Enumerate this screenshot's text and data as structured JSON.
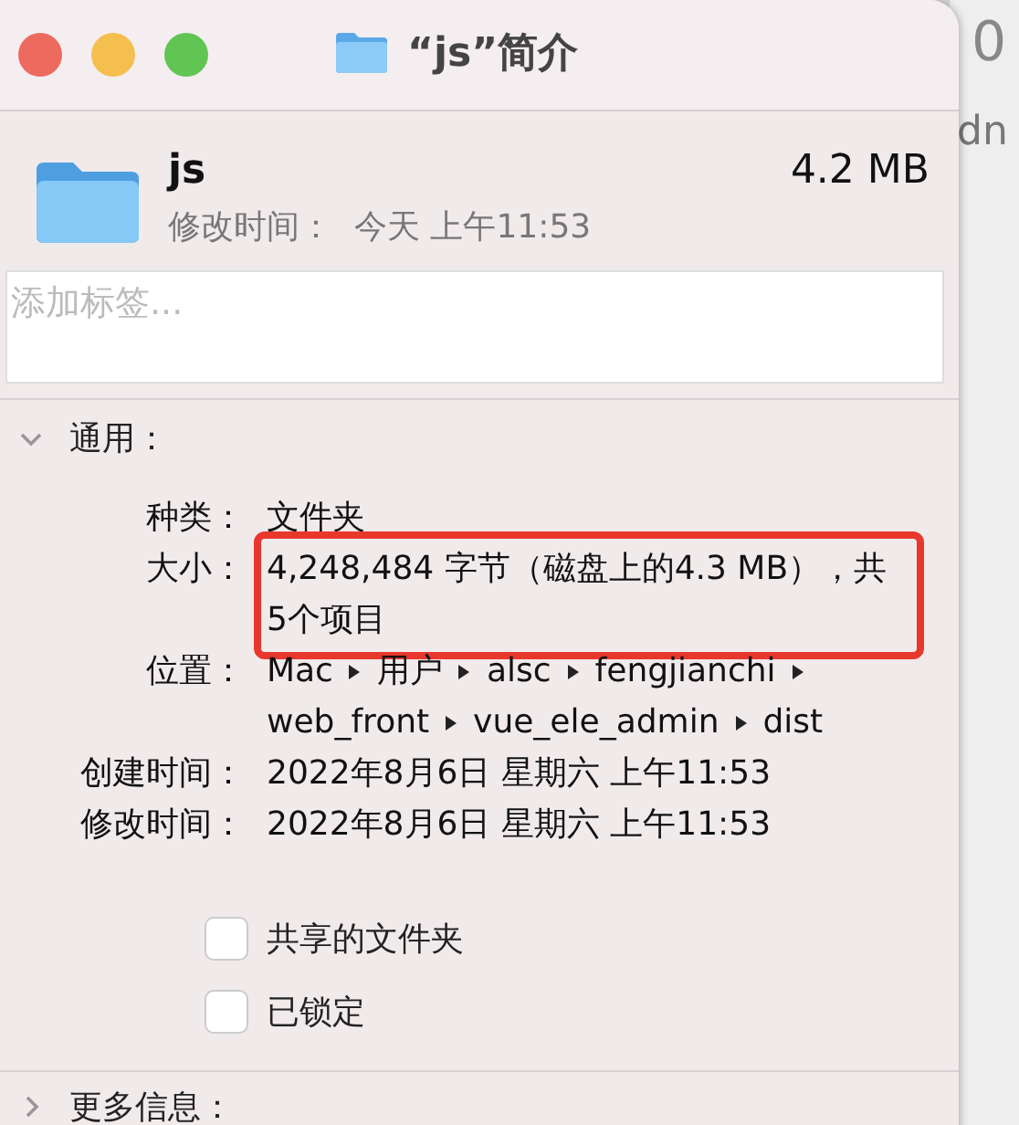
{
  "background_window": {
    "texts": [
      "0",
      "dn"
    ]
  },
  "window": {
    "title": "“js”简介"
  },
  "header": {
    "name": "js",
    "size": "4.2 MB",
    "modified_label": "修改时间：",
    "modified_value": "今天 上午11:53"
  },
  "tags_field": {
    "placeholder": "添加标签..."
  },
  "general": {
    "title": "通用：",
    "expanded": true,
    "rows": [
      {
        "kind": "text",
        "label": "种类：",
        "value": "文件夹",
        "highlighted": false
      },
      {
        "kind": "text",
        "label": "大小：",
        "value": "4,248,484 字节（磁盘上的4.3 MB），共5个项目",
        "highlighted": true
      },
      {
        "kind": "path",
        "label": "位置：",
        "segments": [
          "Mac",
          "用户",
          "alsc",
          "fengjianchi",
          "web_front",
          "vue_ele_admin",
          "dist"
        ]
      },
      {
        "kind": "text",
        "label": "创建时间：",
        "value": "2022年8月6日 星期六 上午11:53",
        "highlighted": false
      },
      {
        "kind": "text",
        "label": "修改时间：",
        "value": "2022年8月6日 星期六 上午11:53",
        "highlighted": false
      }
    ],
    "checkboxes": [
      {
        "label": "共享的文件夹",
        "checked": false
      },
      {
        "label": "已锁定",
        "checked": false
      }
    ]
  },
  "more_info": {
    "title": "更多信息：",
    "expanded": false
  }
}
